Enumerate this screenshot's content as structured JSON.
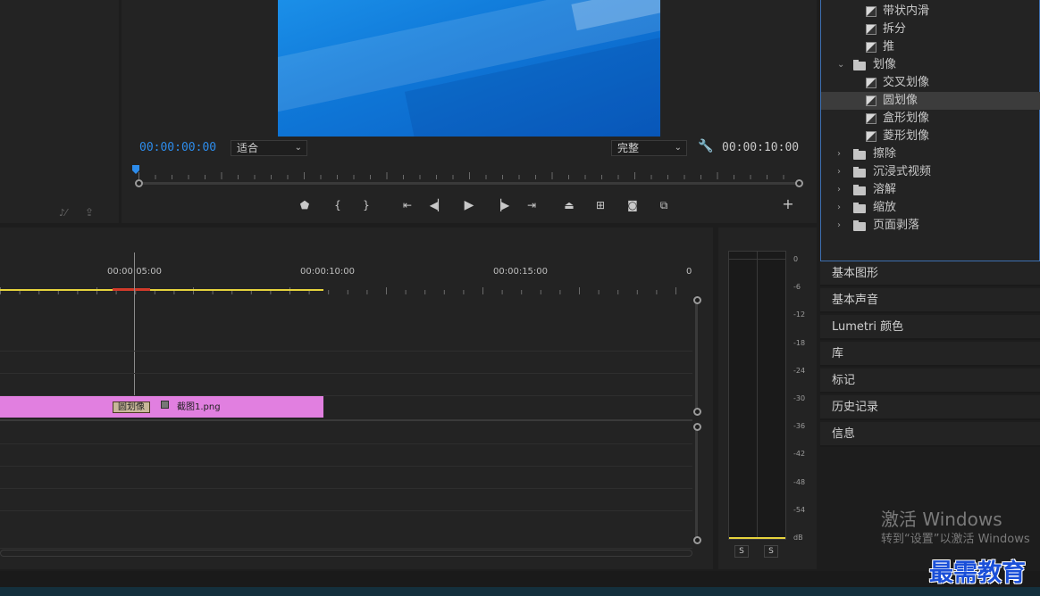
{
  "program_monitor": {
    "current_time": "00:00:00:00",
    "fit_label": "适合",
    "quality_label": "完整",
    "duration": "00:00:10:00"
  },
  "timeline": {
    "ruler_labels": [
      "00:00:05:00",
      "00:00:10:00",
      "00:00:15:00",
      "0"
    ],
    "transition_label": "圆划像",
    "clip_name": "截图1.png"
  },
  "audio_meter": {
    "db_labels": [
      "0",
      "-6",
      "-12",
      "-18",
      "-24",
      "-30",
      "-36",
      "-42",
      "-48",
      "-54",
      "dB"
    ],
    "solo_left": "S",
    "solo_right": "S"
  },
  "effects_tree": {
    "items": [
      {
        "label": "带状内滑",
        "type": "effect"
      },
      {
        "label": "拆分",
        "type": "effect"
      },
      {
        "label": "推",
        "type": "effect"
      },
      {
        "label": "划像",
        "type": "folder-open"
      },
      {
        "label": "交叉划像",
        "type": "effect"
      },
      {
        "label": "圆划像",
        "type": "effect",
        "selected": true
      },
      {
        "label": "盒形划像",
        "type": "effect"
      },
      {
        "label": "菱形划像",
        "type": "effect"
      },
      {
        "label": "擦除",
        "type": "folder"
      },
      {
        "label": "沉浸式视频",
        "type": "folder"
      },
      {
        "label": "溶解",
        "type": "folder"
      },
      {
        "label": "缩放",
        "type": "folder"
      },
      {
        "label": "页面剥落",
        "type": "folder"
      }
    ]
  },
  "side_panels": [
    "基本图形",
    "基本声音",
    "Lumetri 颜色",
    "库",
    "标记",
    "历史记录",
    "信息"
  ],
  "watermark": {
    "line1": "激活 Windows",
    "line2": "转到“设置”以激活 Windows",
    "logo": "最需教育"
  },
  "colors": {
    "accent_blue": "#2d8ceb",
    "clip_pink": "#e17fe0",
    "work_area_yellow": "#e6d33c"
  }
}
